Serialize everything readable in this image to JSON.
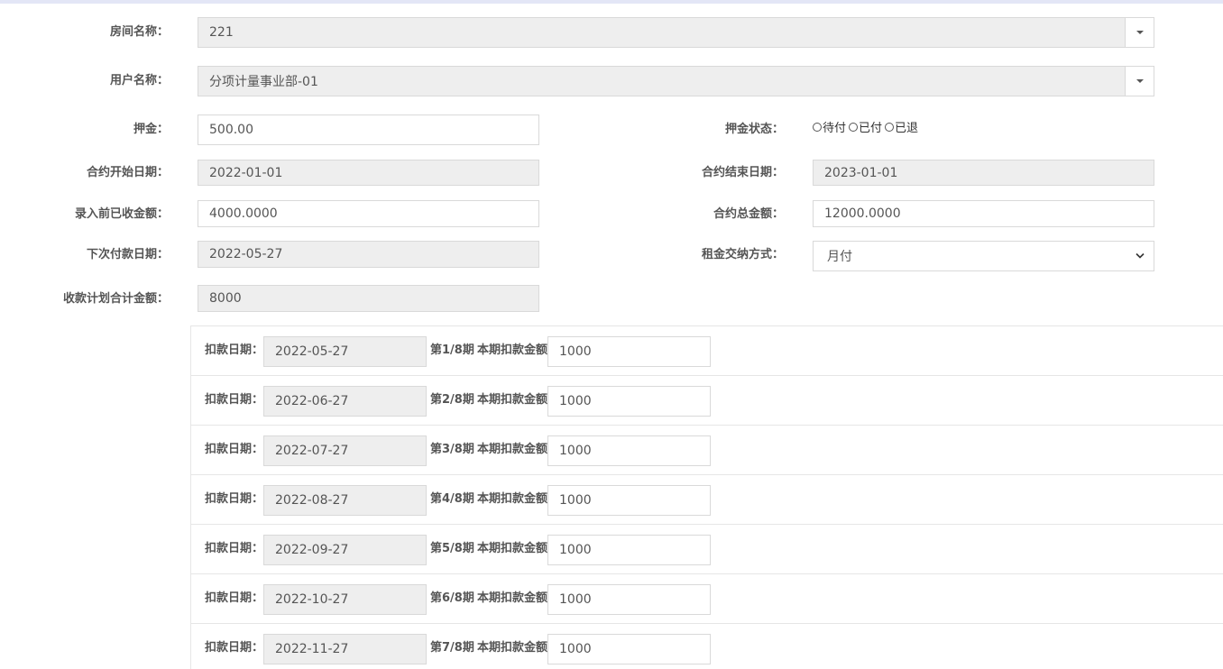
{
  "form": {
    "room_name": {
      "label": "房间名称：",
      "value": "221"
    },
    "user_name": {
      "label": "用户名称：",
      "value": "分项计量事业部-01"
    },
    "deposit": {
      "label": "押金：",
      "value": "500.00"
    },
    "deposit_status": {
      "label": "押金状态：",
      "options": [
        "待付",
        "已付",
        "已退"
      ]
    },
    "contract_start": {
      "label": "合约开始日期：",
      "value": "2022-01-01"
    },
    "contract_end": {
      "label": "合约结束日期：",
      "value": "2023-01-01"
    },
    "received_before": {
      "label": "录入前已收金额：",
      "value": "4000.0000"
    },
    "contract_total": {
      "label": "合约总金额：",
      "value": "12000.0000"
    },
    "next_payment_date": {
      "label": "下次付款日期：",
      "value": "2022-05-27"
    },
    "rent_payment_method": {
      "label": "租金交纳方式：",
      "value": "月付"
    },
    "plan_total": {
      "label": "收款计划合计金额：",
      "value": "8000"
    }
  },
  "plan": {
    "date_label": "扣款日期：",
    "amount_label": "本期扣款金额",
    "rows": [
      {
        "period": "第1/8期",
        "date": "2022-05-27",
        "amount": "1000"
      },
      {
        "period": "第2/8期",
        "date": "2022-06-27",
        "amount": "1000"
      },
      {
        "period": "第3/8期",
        "date": "2022-07-27",
        "amount": "1000"
      },
      {
        "period": "第4/8期",
        "date": "2022-08-27",
        "amount": "1000"
      },
      {
        "period": "第5/8期",
        "date": "2022-09-27",
        "amount": "1000"
      },
      {
        "period": "第6/8期",
        "date": "2022-10-27",
        "amount": "1000"
      },
      {
        "period": "第7/8期",
        "date": "2022-11-27",
        "amount": "1000"
      }
    ]
  },
  "icons": {
    "combo_caret": "caret-down-icon",
    "select_chevron": "chevron-down-icon",
    "radio": "radio-unchecked-icon"
  }
}
